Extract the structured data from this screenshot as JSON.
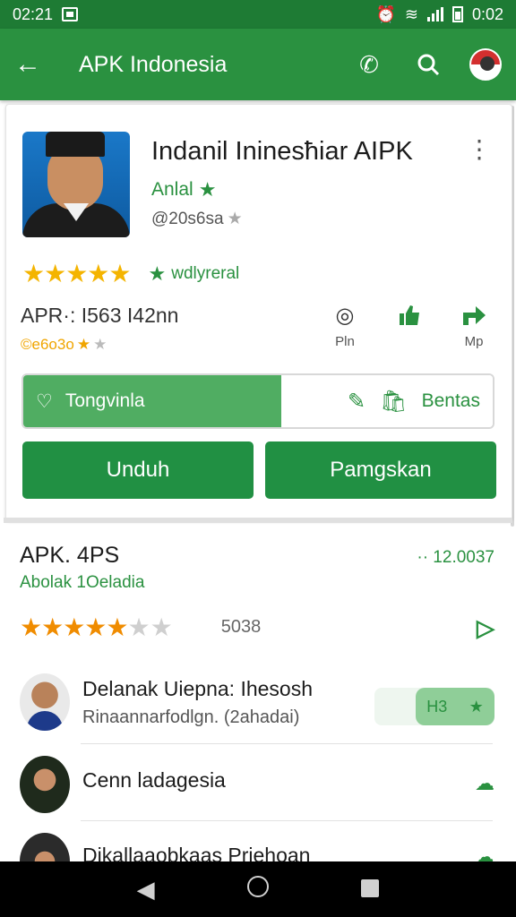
{
  "status_bar": {
    "time_left": "02:21",
    "time_right": "0:02"
  },
  "app_bar": {
    "back_icon": "←",
    "title": "APK Indonesia",
    "phone_icon": "✆",
    "search_icon": "⚲"
  },
  "app": {
    "name": "Indanil Ininesħiar AIPK",
    "developer": "Anlal",
    "package": "@20s6sa",
    "rating_stars": "★★★★★",
    "verified_label": "wdlyreral",
    "version": "APR·: I563 I42nn",
    "downloads": "©e6o3o"
  },
  "mini_actions": [
    {
      "icon": "◎",
      "label": "Pln"
    },
    {
      "icon": "👍",
      "label": ""
    },
    {
      "icon": "➦",
      "label": "Mp"
    }
  ],
  "split_button": {
    "left_label": "Tongvinla",
    "right_label": "Bentas"
  },
  "buttons": {
    "install": "Unduh",
    "update": "Pamgskan"
  },
  "section": {
    "title": "APK. 4PS",
    "subtitle": "Abolak 1Oeladia",
    "meta": "·· 12.0037",
    "rating_stars": "★★★★★",
    "rating_empty": "★★",
    "rating_count": "5038"
  },
  "list": [
    {
      "title": "Delanak Uiepna: Ihesosh",
      "subtitle": "Rinaannarfodlgn. (2ahadai)",
      "chip_label": "H3"
    },
    {
      "title": "Cenn ladagesia",
      "subtitle": ""
    },
    {
      "title": "Dikallaaobkaas Priehoan",
      "subtitle": ""
    }
  ]
}
